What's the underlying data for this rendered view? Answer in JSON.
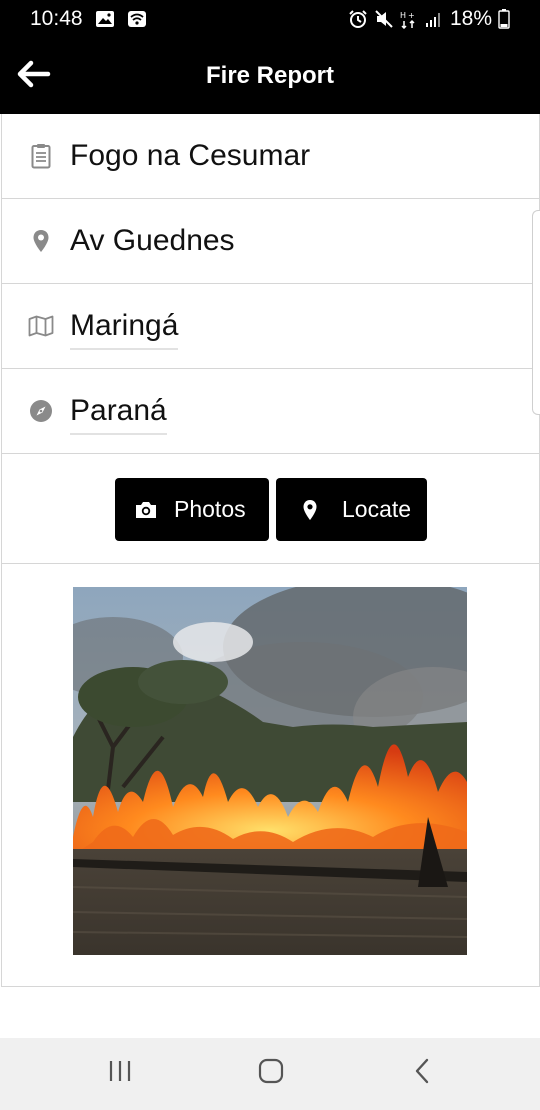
{
  "status_bar": {
    "time": "10:48",
    "battery": "18%",
    "left_icons": [
      "image-icon",
      "wifi-icon"
    ],
    "right_icons": [
      "alarm-icon",
      "mute-icon",
      "data-icon",
      "signal-icon",
      "battery-icon"
    ]
  },
  "app_bar": {
    "title": "Fire Report",
    "back_icon": "arrow-left-icon"
  },
  "form": {
    "title": {
      "value": "Fogo na Cesumar",
      "icon": "clipboard-icon"
    },
    "street": {
      "value": "Av Guednes",
      "icon": "map-pin-icon"
    },
    "city": {
      "value": "Maringá",
      "icon": "map-icon"
    },
    "state": {
      "value": "Paraná",
      "icon": "compass-icon"
    }
  },
  "actions": {
    "photos_label": "Photos",
    "photos_icon": "camera-icon",
    "locate_label": "Locate",
    "locate_icon": "map-pin-icon"
  },
  "photo": {
    "subject": "wildfire burning grassland and trees"
  },
  "nav_bar": {
    "icons": [
      "recents-icon",
      "home-icon",
      "back-icon"
    ]
  },
  "colors": {
    "app_bar": "#000000",
    "button": "#000000",
    "icon_gray": "#8a8a8a",
    "nav_bg": "#f0f0f0"
  }
}
